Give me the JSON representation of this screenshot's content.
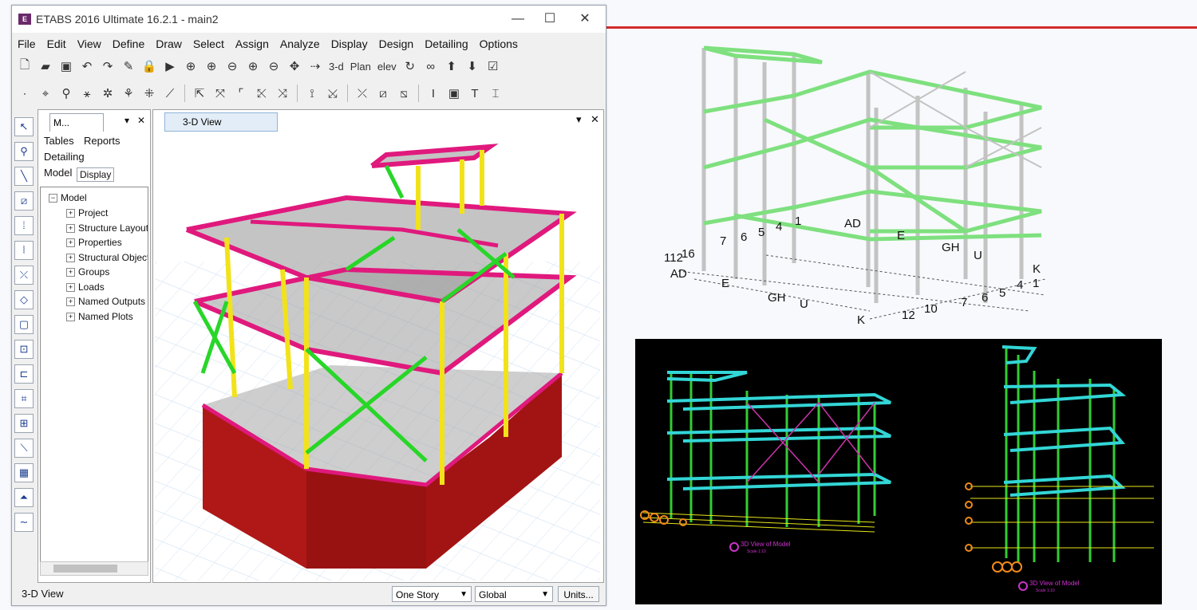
{
  "window": {
    "title": "ETABS 2016 Ultimate 16.2.1 - main2",
    "icon_text": "ETABS",
    "minimize": "—",
    "maximize": "☐",
    "close": "✕"
  },
  "menu": [
    "File",
    "Edit",
    "View",
    "Define",
    "Draw",
    "Select",
    "Assign",
    "Analyze",
    "Display",
    "Design",
    "Detailing",
    "Options"
  ],
  "toolbar": {
    "view_3d_label": "3-d",
    "plan_label": "Plan",
    "elev_label": "elev"
  },
  "model_panel": {
    "tab_label": "M...",
    "tabs": [
      "Tables",
      "Reports",
      "Detailing",
      "Model",
      "Display"
    ],
    "tree_root": "Model",
    "tree_items": [
      "Project",
      "Structure Layout",
      "Properties",
      "Structural Objects",
      "Groups",
      "Loads",
      "Named Outputs",
      "Named Plots"
    ]
  },
  "view_panel": {
    "tab_label": "3-D View"
  },
  "status": {
    "view_name": "3-D View",
    "story_option": "One Story",
    "coord_option": "Global",
    "units_label": "Units..."
  },
  "grid_labels_a": {
    "left": [
      "112",
      "16",
      "7",
      "6",
      "5",
      "4",
      "1",
      "AD",
      "E",
      "GH",
      "U"
    ],
    "right": [
      "AD",
      "E",
      "GH",
      "U",
      "K",
      "1",
      "4",
      "5",
      "6",
      "7",
      "10",
      "12"
    ],
    "bottom": [
      "K",
      "112",
      "16",
      "7",
      "6",
      "5",
      "4",
      "1"
    ]
  },
  "cad_captions": {
    "left": "3D View of Model",
    "left_scale": "Scale 1:10",
    "right": "3D View of Model",
    "right_scale": "Scale 1:10"
  },
  "colors": {
    "accent_red": "#d12b2b",
    "beam_pink": "#e0197d",
    "column_yellow": "#f2e21a",
    "brace_green": "#28d628",
    "wall_red": "#b01818",
    "cad_cyan": "#33d6d6",
    "cad_green": "#33cc33",
    "cad_yellow": "#e6e619"
  }
}
